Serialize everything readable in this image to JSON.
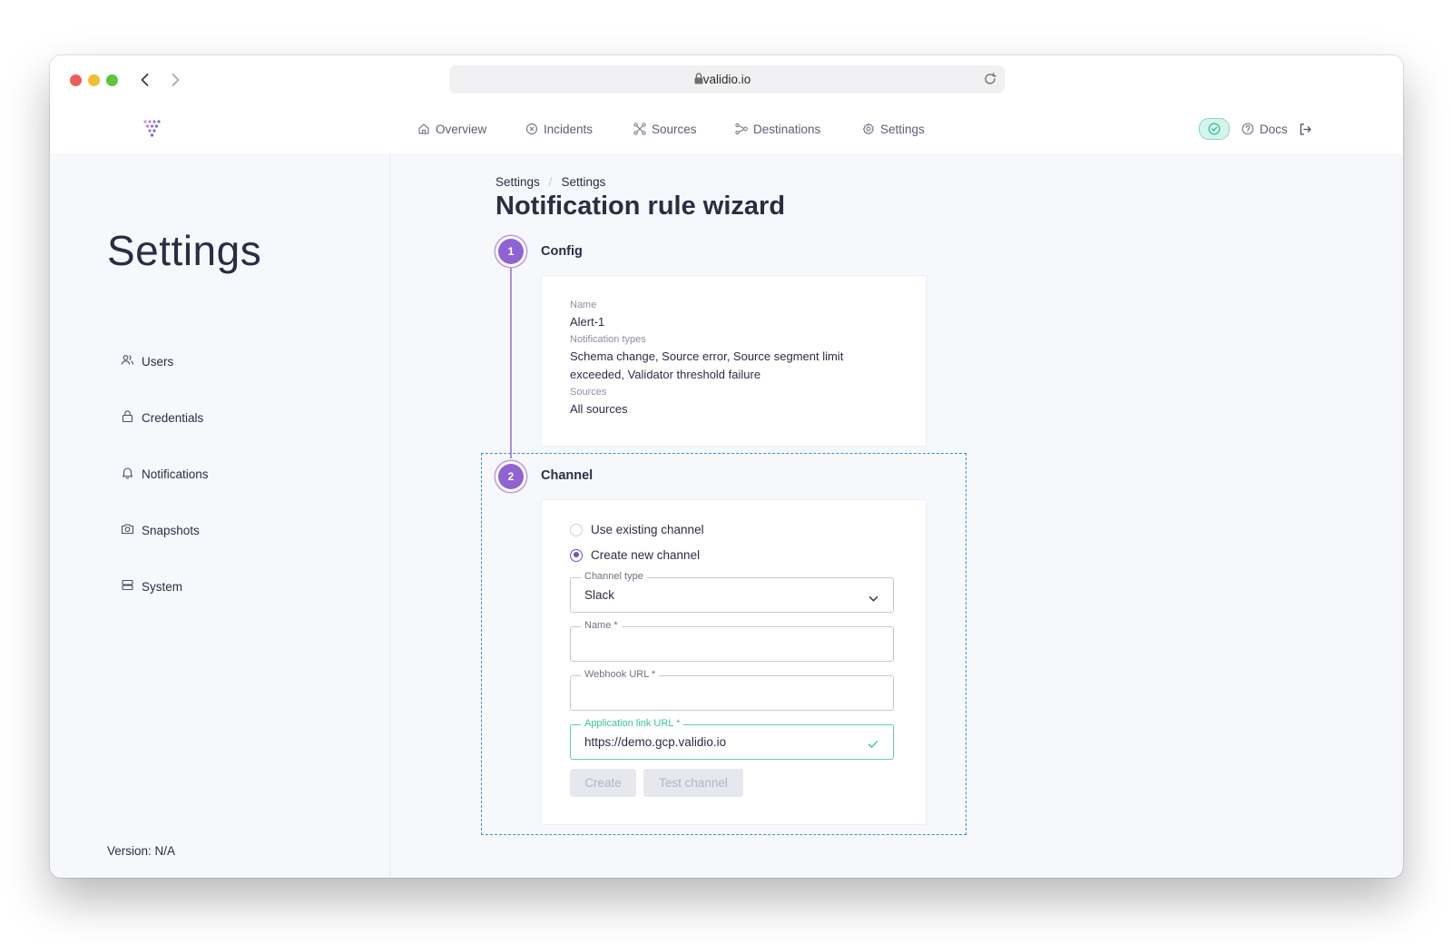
{
  "browser": {
    "url": "validio.io"
  },
  "nav": {
    "overview": "Overview",
    "incidents": "Incidents",
    "sources": "Sources",
    "destinations": "Destinations",
    "settings": "Settings",
    "docs": "Docs"
  },
  "sidebar": {
    "title": "Settings",
    "items": [
      {
        "label": "Users",
        "icon": "users-icon"
      },
      {
        "label": "Credentials",
        "icon": "lock-icon"
      },
      {
        "label": "Notifications",
        "icon": "bell-icon"
      },
      {
        "label": "Snapshots",
        "icon": "camera-icon"
      },
      {
        "label": "System",
        "icon": "server-icon"
      }
    ],
    "version": "Version: N/A"
  },
  "breadcrumb": [
    "Settings",
    "Settings"
  ],
  "page_title": "Notification rule wizard",
  "steps": [
    {
      "number": "1",
      "label": "Config",
      "fields": {
        "name_label": "Name",
        "name_value": "Alert-1",
        "types_label": "Notification types",
        "types_value": "Schema change, Source error, Source segment limit exceeded, Validator threshold failure",
        "sources_label": "Sources",
        "sources_value": "All sources"
      }
    },
    {
      "number": "2",
      "label": "Channel",
      "options": {
        "existing": "Use existing channel",
        "new": "Create new channel",
        "selected": "new"
      },
      "channel_type_label": "Channel type",
      "channel_type_value": "Slack",
      "name_label": "Name *",
      "name_value": "",
      "webhook_label": "Webhook URL *",
      "webhook_value": "",
      "app_link_label": "Application link URL *",
      "app_link_value": "https://demo.gcp.validio.io",
      "create_button": "Create",
      "test_button": "Test channel"
    }
  ],
  "colors": {
    "accent": "#8f63d3",
    "success": "#3cc29c",
    "focus_dash": "#3a8fd0"
  }
}
